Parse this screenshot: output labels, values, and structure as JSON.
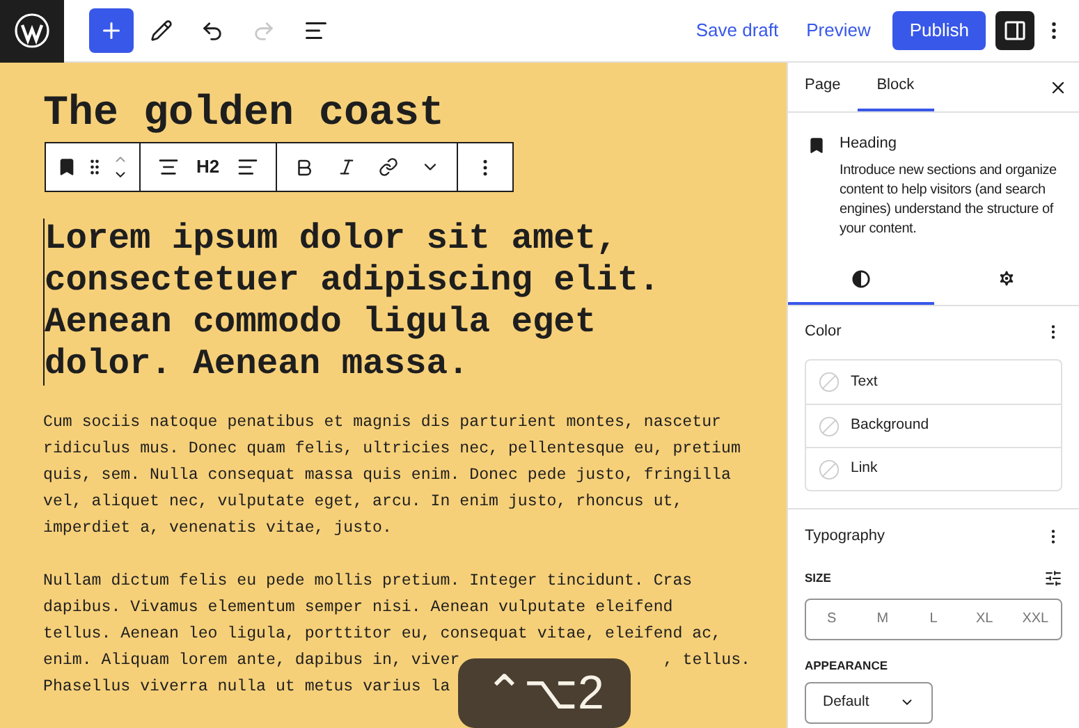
{
  "header": {
    "redo": {
      "disabled": true
    },
    "save_draft": "Save draft",
    "preview": "Preview",
    "publish": "Publish",
    "settings_toggle": {
      "pressed": true
    }
  },
  "canvas": {
    "title": "The golden coast",
    "block_toolbar": {
      "heading_level": "H2"
    },
    "heading": "Lorem ipsum dolor sit amet, consectetuer adipiscing elit. Aenean commodo ligula eget dolor. Aenean massa.",
    "paragraphs": [
      "Cum sociis natoque penatibus et magnis dis parturient montes, nascetur ridiculus mus. Donec quam felis, ultricies nec, pellentesque eu, pretium quis, sem. Nulla consequat massa quis enim. Donec pede justo, fringilla vel, aliquet nec, vulputate eget, arcu. In enim justo, rhoncus ut, imperdiet a, venenatis vitae, justo.",
      [
        [
          "Nullam dictum felis eu pede mollis pretium. Integer tincidunt. Cras"
        ],
        [
          "dapibus. Vivamus elementum semper nisi. Aenean vulputate eleifend"
        ],
        [
          "tellus. Aenean leo ligula, porttitor eu, consequat vitae, eleifend ac,"
        ],
        [
          "enim. Aliquam lorem ante, dapibus in, viver",
          ", tellus."
        ],
        [
          "Phasellus viverra nulla ut metus varius la"
        ]
      ]
    ],
    "shortcut_overlay": "⌃⌥2"
  },
  "sidebar": {
    "tabs": [
      {
        "label": "Page",
        "selected": false
      },
      {
        "label": "Block",
        "selected": true
      }
    ],
    "block_card": {
      "title": "Heading",
      "description": "Introduce new sections and organize content to help visitors (and search engines) understand the structure of your content."
    },
    "style_tabs": [
      {
        "kind": "styles",
        "selected": true
      },
      {
        "kind": "settings",
        "selected": false
      }
    ],
    "color": {
      "title": "Color",
      "items": [
        "Text",
        "Background",
        "Link"
      ]
    },
    "typography": {
      "title": "Typography",
      "size_label": "SIZE",
      "sizes": [
        {
          "label": "S",
          "selected": false
        },
        {
          "label": "M",
          "selected": false
        },
        {
          "label": "L",
          "selected": false
        },
        {
          "label": "XL",
          "selected": false
        },
        {
          "label": "XXL",
          "selected": false
        }
      ],
      "appearance_label": "APPEARANCE",
      "appearance_value": "Default"
    }
  }
}
